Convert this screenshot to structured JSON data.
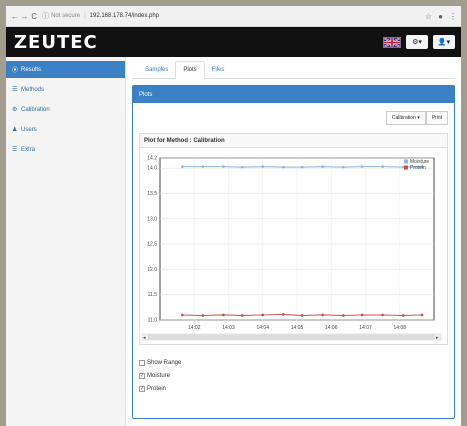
{
  "browser": {
    "back": "←",
    "forward": "→",
    "reload": "C",
    "security_label": "Not secure",
    "url": "192.168.178.74/index.php"
  },
  "header": {
    "logo": "ZEUTEC",
    "settings_label": "⚙▾",
    "user_label": "👤▾"
  },
  "sidebar": {
    "items": [
      {
        "label": "Results",
        "icon": "results-icon",
        "glyph": "⦿",
        "active": true
      },
      {
        "label": "Methods",
        "icon": "list-icon",
        "glyph": "☰",
        "active": false
      },
      {
        "label": "Calibration",
        "icon": "calibration-icon",
        "glyph": "⚙",
        "active": false
      },
      {
        "label": "Users",
        "icon": "user-icon",
        "glyph": "♟",
        "active": false
      },
      {
        "label": "Extra",
        "icon": "extra-icon",
        "glyph": "☰",
        "active": false
      }
    ]
  },
  "tabs": [
    {
      "label": "Samples",
      "active": false
    },
    {
      "label": "Plots",
      "active": true
    },
    {
      "label": "Files",
      "active": false
    }
  ],
  "panel": {
    "title": "Plots",
    "calibration_button": "Calibration ▾",
    "print_button": "Print",
    "chart_title": "Plot for Method : Calibration"
  },
  "chart_data": {
    "type": "line",
    "title": "Plot for Method : Calibration",
    "ylim": [
      11.0,
      14.2
    ],
    "y_ticks": [
      "11.0",
      "11.5",
      "12.0",
      "12.5",
      "13.0",
      "13.5",
      "14.0",
      "14.2"
    ],
    "x_ticks": [
      "14:02",
      "14:03",
      "14:04",
      "14:05",
      "14:06",
      "14:07",
      "14:08"
    ],
    "x": [
      14.013,
      14.025,
      14.037,
      14.048,
      14.06,
      14.072,
      14.083,
      14.095,
      14.107,
      14.118,
      14.13,
      14.142,
      14.153
    ],
    "series": [
      {
        "name": "Moisture",
        "color": "#8fb3d9",
        "values": [
          14.03,
          14.03,
          14.03,
          14.02,
          14.03,
          14.02,
          14.02,
          14.03,
          14.02,
          14.03,
          14.03,
          14.02,
          14.03
        ]
      },
      {
        "name": "Protein",
        "color": "#c0504d",
        "values": [
          11.1,
          11.09,
          11.1,
          11.09,
          11.1,
          11.11,
          11.09,
          11.1,
          11.09,
          11.1,
          11.1,
          11.09,
          11.1
        ]
      }
    ],
    "grid": true,
    "legend_position": "top-right"
  },
  "options": [
    {
      "label": "Show Range",
      "checked": false
    },
    {
      "label": "Moisture",
      "checked": true
    },
    {
      "label": "Protein",
      "checked": true
    }
  ]
}
